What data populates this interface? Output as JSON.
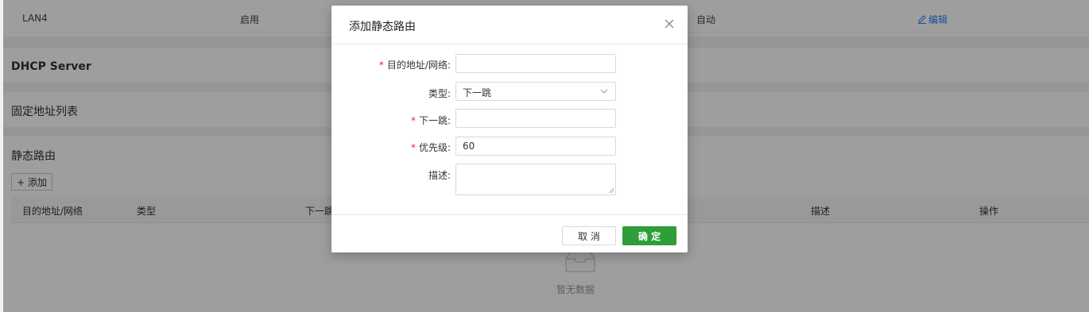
{
  "top_row": {
    "interface": "LAN4",
    "status": "启用",
    "mode": "自动",
    "edit_label": "编辑"
  },
  "sections": {
    "dhcp_server": "DHCP Server",
    "fixed_address": "固定地址列表",
    "static_route": "静态路由"
  },
  "add_button": "+ 添加",
  "table": {
    "headers": [
      "目的地址/网络",
      "类型",
      "下一跳",
      "描述",
      "操作"
    ],
    "empty_text": "暂无数据"
  },
  "modal": {
    "title": "添加静态路由",
    "fields": {
      "destination": {
        "label": "目的地址/网络:",
        "value": ""
      },
      "type": {
        "label": "类型:",
        "value": "下一跳"
      },
      "next_hop": {
        "label": "下一跳:",
        "value": ""
      },
      "priority": {
        "label": "优先级:",
        "value": "60"
      },
      "description": {
        "label": "描述:",
        "value": ""
      }
    },
    "cancel": "取 消",
    "ok": "确 定"
  },
  "colors": {
    "primary": "#2e9d3a",
    "required": "#f5222d",
    "link": "#2f7df6"
  }
}
